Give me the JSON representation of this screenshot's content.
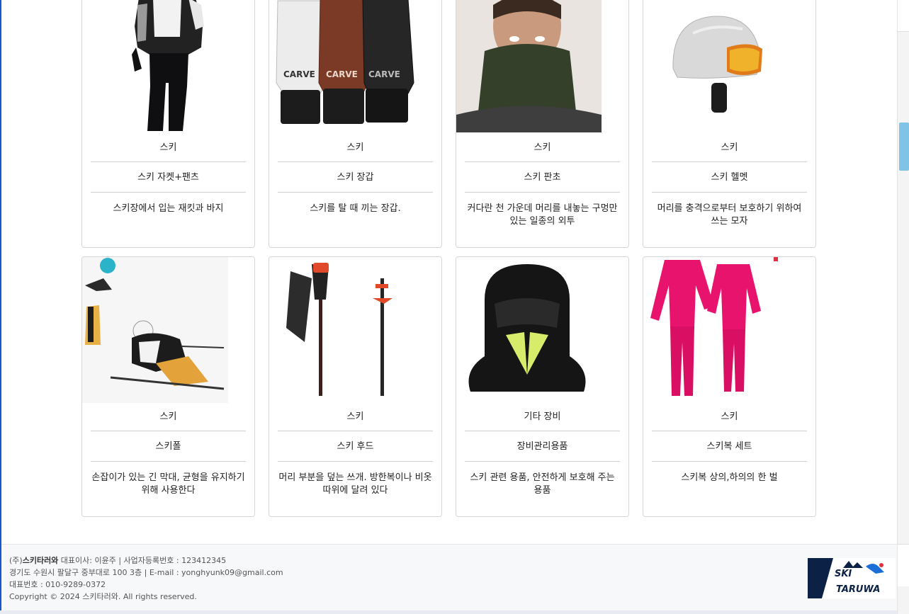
{
  "products": [
    {
      "category": "스키",
      "name": "스키 자켓+팬츠",
      "description": "스키장에서 입는 재킷과 바지",
      "icon": "ski-jacket-pants-image"
    },
    {
      "category": "스키",
      "name": "스키 장갑",
      "description": "스키를 탈 때 끼는 장갑.",
      "icon": "ski-gloves-image",
      "brand_mark": "CARVE"
    },
    {
      "category": "스키",
      "name": "스키 판초",
      "description": "커다란 천 가운데 머리를 내놓는 구멍만 있는 일종의 외투",
      "icon": "ski-poncho-image"
    },
    {
      "category": "스키",
      "name": "스키 헬멧",
      "description": "머리를 충격으로부터 보호하기 위하여 쓰는 모자",
      "icon": "ski-helmet-image"
    },
    {
      "category": "스키",
      "name": "스키폴",
      "description": "손잡이가 있는 긴 막대, 균형을 유지하기 위해 사용한다",
      "icon": "ski-pole-image"
    },
    {
      "category": "스키",
      "name": "스키 후드",
      "description": "머리 부분을 덮는 쓰개. 방한복이나 비옷 따위에 달려 있다",
      "icon": "ski-hood-image"
    },
    {
      "category": "기타 장비",
      "name": "장비관리용품",
      "description": "스키 관련 용품, 안전하게 보호해 주는 용품",
      "icon": "equipment-care-image"
    },
    {
      "category": "스키",
      "name": "스키복 세트",
      "description": "스키복 상의,하의의 한 벌",
      "icon": "ski-suit-set-image"
    }
  ],
  "footer": {
    "company_prefix": "(주)",
    "company_name": "스키타러와",
    "company_rest": " 대표이사: 이윤주 | 사업자등록번호 : 123412345",
    "address_line": "경기도 수원시 팔달구 중부대로 100 3층 | E-mail : yonghyunk09@gmail.com",
    "phone_line": "대표번호 : 010-9289-0372",
    "copyright": "Copyright © 2024 스키타러와. All rights reserved.",
    "logo_top": "SKI",
    "logo_bottom": "TARUWA"
  },
  "colors": {
    "card_border": "#d6d6d6",
    "divider": "#cfcfcf",
    "footer_bg": "#f7f8fa",
    "scroll_thumb": "#7fc3e6",
    "logo_navy": "#0b2145",
    "accent_blue": "#1a56c9"
  }
}
